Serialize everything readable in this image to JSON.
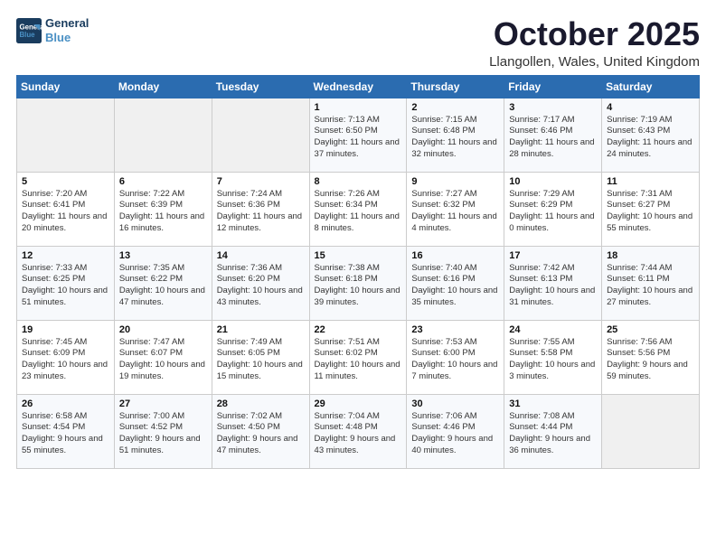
{
  "logo": {
    "line1": "General",
    "line2": "Blue"
  },
  "title": "October 2025",
  "location": "Llangollen, Wales, United Kingdom",
  "days_header": [
    "Sunday",
    "Monday",
    "Tuesday",
    "Wednesday",
    "Thursday",
    "Friday",
    "Saturday"
  ],
  "weeks": [
    [
      {
        "day": "",
        "empty": true
      },
      {
        "day": "",
        "empty": true
      },
      {
        "day": "",
        "empty": true
      },
      {
        "day": "1",
        "sunrise": "7:13 AM",
        "sunset": "6:50 PM",
        "daylight": "11 hours and 37 minutes."
      },
      {
        "day": "2",
        "sunrise": "7:15 AM",
        "sunset": "6:48 PM",
        "daylight": "11 hours and 32 minutes."
      },
      {
        "day": "3",
        "sunrise": "7:17 AM",
        "sunset": "6:46 PM",
        "daylight": "11 hours and 28 minutes."
      },
      {
        "day": "4",
        "sunrise": "7:19 AM",
        "sunset": "6:43 PM",
        "daylight": "11 hours and 24 minutes."
      }
    ],
    [
      {
        "day": "5",
        "sunrise": "7:20 AM",
        "sunset": "6:41 PM",
        "daylight": "11 hours and 20 minutes."
      },
      {
        "day": "6",
        "sunrise": "7:22 AM",
        "sunset": "6:39 PM",
        "daylight": "11 hours and 16 minutes."
      },
      {
        "day": "7",
        "sunrise": "7:24 AM",
        "sunset": "6:36 PM",
        "daylight": "11 hours and 12 minutes."
      },
      {
        "day": "8",
        "sunrise": "7:26 AM",
        "sunset": "6:34 PM",
        "daylight": "11 hours and 8 minutes."
      },
      {
        "day": "9",
        "sunrise": "7:27 AM",
        "sunset": "6:32 PM",
        "daylight": "11 hours and 4 minutes."
      },
      {
        "day": "10",
        "sunrise": "7:29 AM",
        "sunset": "6:29 PM",
        "daylight": "11 hours and 0 minutes."
      },
      {
        "day": "11",
        "sunrise": "7:31 AM",
        "sunset": "6:27 PM",
        "daylight": "10 hours and 55 minutes."
      }
    ],
    [
      {
        "day": "12",
        "sunrise": "7:33 AM",
        "sunset": "6:25 PM",
        "daylight": "10 hours and 51 minutes."
      },
      {
        "day": "13",
        "sunrise": "7:35 AM",
        "sunset": "6:22 PM",
        "daylight": "10 hours and 47 minutes."
      },
      {
        "day": "14",
        "sunrise": "7:36 AM",
        "sunset": "6:20 PM",
        "daylight": "10 hours and 43 minutes."
      },
      {
        "day": "15",
        "sunrise": "7:38 AM",
        "sunset": "6:18 PM",
        "daylight": "10 hours and 39 minutes."
      },
      {
        "day": "16",
        "sunrise": "7:40 AM",
        "sunset": "6:16 PM",
        "daylight": "10 hours and 35 minutes."
      },
      {
        "day": "17",
        "sunrise": "7:42 AM",
        "sunset": "6:13 PM",
        "daylight": "10 hours and 31 minutes."
      },
      {
        "day": "18",
        "sunrise": "7:44 AM",
        "sunset": "6:11 PM",
        "daylight": "10 hours and 27 minutes."
      }
    ],
    [
      {
        "day": "19",
        "sunrise": "7:45 AM",
        "sunset": "6:09 PM",
        "daylight": "10 hours and 23 minutes."
      },
      {
        "day": "20",
        "sunrise": "7:47 AM",
        "sunset": "6:07 PM",
        "daylight": "10 hours and 19 minutes."
      },
      {
        "day": "21",
        "sunrise": "7:49 AM",
        "sunset": "6:05 PM",
        "daylight": "10 hours and 15 minutes."
      },
      {
        "day": "22",
        "sunrise": "7:51 AM",
        "sunset": "6:02 PM",
        "daylight": "10 hours and 11 minutes."
      },
      {
        "day": "23",
        "sunrise": "7:53 AM",
        "sunset": "6:00 PM",
        "daylight": "10 hours and 7 minutes."
      },
      {
        "day": "24",
        "sunrise": "7:55 AM",
        "sunset": "5:58 PM",
        "daylight": "10 hours and 3 minutes."
      },
      {
        "day": "25",
        "sunrise": "7:56 AM",
        "sunset": "5:56 PM",
        "daylight": "9 hours and 59 minutes."
      }
    ],
    [
      {
        "day": "26",
        "sunrise": "6:58 AM",
        "sunset": "4:54 PM",
        "daylight": "9 hours and 55 minutes."
      },
      {
        "day": "27",
        "sunrise": "7:00 AM",
        "sunset": "4:52 PM",
        "daylight": "9 hours and 51 minutes."
      },
      {
        "day": "28",
        "sunrise": "7:02 AM",
        "sunset": "4:50 PM",
        "daylight": "9 hours and 47 minutes."
      },
      {
        "day": "29",
        "sunrise": "7:04 AM",
        "sunset": "4:48 PM",
        "daylight": "9 hours and 43 minutes."
      },
      {
        "day": "30",
        "sunrise": "7:06 AM",
        "sunset": "4:46 PM",
        "daylight": "9 hours and 40 minutes."
      },
      {
        "day": "31",
        "sunrise": "7:08 AM",
        "sunset": "4:44 PM",
        "daylight": "9 hours and 36 minutes."
      },
      {
        "day": "",
        "empty": true
      }
    ]
  ]
}
